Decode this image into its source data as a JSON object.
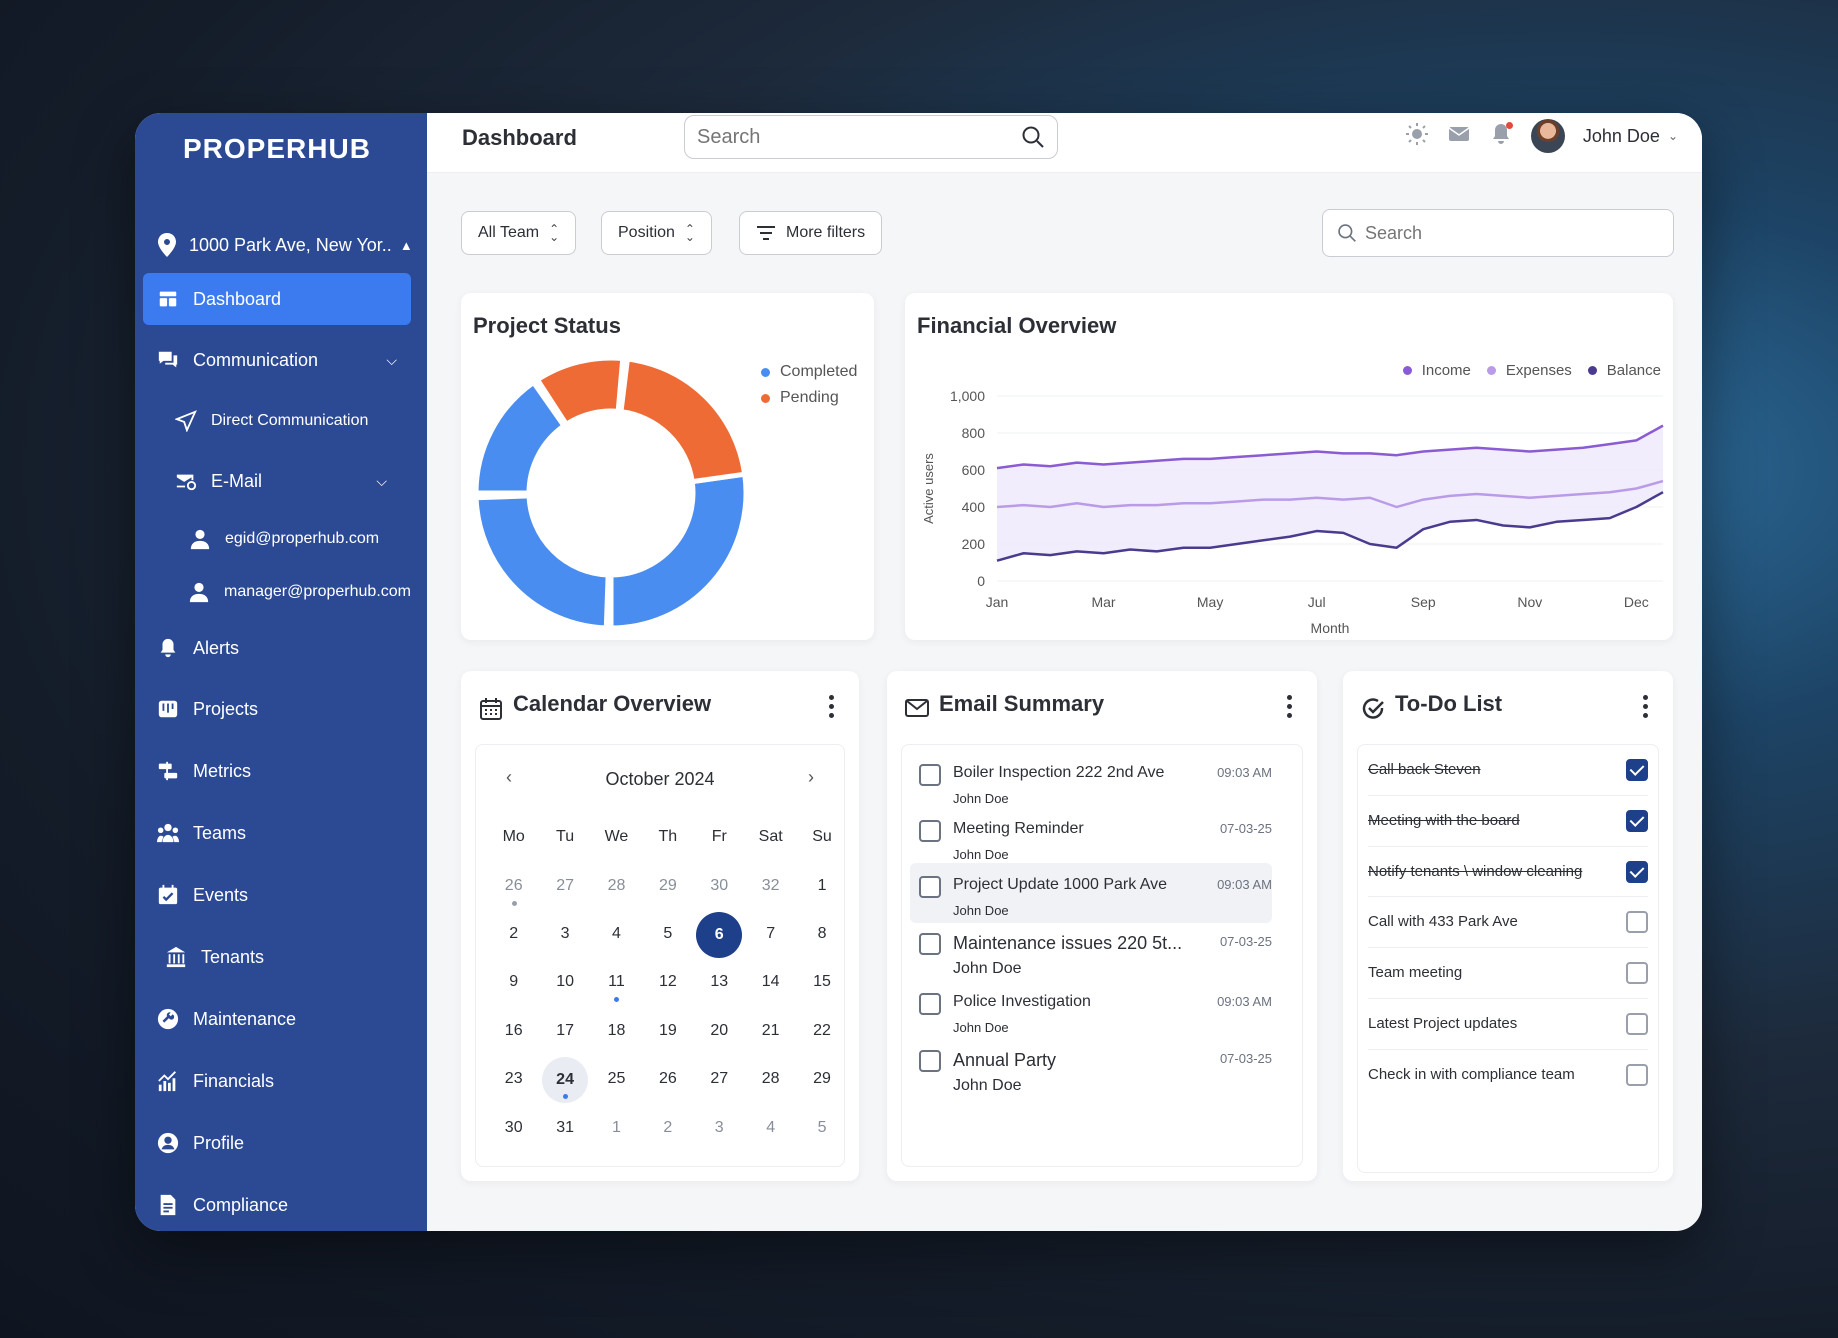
{
  "sidebar": {
    "logo": "PROPERHUB",
    "location": "1000 Park Ave, New Yor..",
    "items": [
      {
        "label": "Dashboard",
        "icon": "dashboard-icon"
      },
      {
        "label": "Communication",
        "icon": "chat-icon"
      },
      {
        "label": "Direct Communication",
        "icon": "send-icon"
      },
      {
        "label": "E-Mail",
        "icon": "mail-at-icon"
      },
      {
        "label": "egid@properhub.com",
        "icon": "user-icon"
      },
      {
        "label": "manager@properhub.com",
        "icon": "user-icon"
      },
      {
        "label": "Alerts",
        "icon": "bell-icon"
      },
      {
        "label": "Projects",
        "icon": "projects-icon"
      },
      {
        "label": "Metrics",
        "icon": "metrics-icon"
      },
      {
        "label": "Teams",
        "icon": "teams-icon"
      },
      {
        "label": "Events",
        "icon": "calendar-check-icon"
      },
      {
        "label": "Tenants",
        "icon": "building-icon"
      },
      {
        "label": "Maintenance",
        "icon": "wrench-icon"
      },
      {
        "label": "Financials",
        "icon": "chart-up-icon"
      },
      {
        "label": "Profile",
        "icon": "profile-icon"
      },
      {
        "label": "Compliance",
        "icon": "document-icon"
      }
    ]
  },
  "header": {
    "title": "Dashboard",
    "search_placeholder": "Search",
    "user_name": "John Doe"
  },
  "filters": {
    "team": "All Team",
    "position": "Position",
    "more": "More filters",
    "search_placeholder": "Search"
  },
  "project_status": {
    "title": "Project Status",
    "legend": [
      "Completed",
      "Pending"
    ],
    "colors": {
      "completed": "#4a8df0",
      "pending": "#ee6b35"
    }
  },
  "financial": {
    "title": "Financial Overview",
    "legend": [
      "Income",
      "Expenses",
      "Balance"
    ],
    "colors": {
      "income": "#8a5bd3",
      "expenses": "#b99be8",
      "balance": "#4a3b8f"
    }
  },
  "chart_data": [
    {
      "type": "pie",
      "title": "Project Status",
      "categories": [
        "Completed",
        "Pending"
      ],
      "values": [
        66,
        34
      ]
    },
    {
      "type": "line",
      "title": "Financial Overview",
      "xlabel": "Month",
      "ylabel": "Active users",
      "ylim": [
        0,
        1000
      ],
      "yticks": [
        "0",
        "200",
        "400",
        "600",
        "800",
        "1,000"
      ],
      "xticks": [
        "Jan",
        "Mar",
        "May",
        "Jul",
        "Sep",
        "Nov",
        "Dec"
      ],
      "legend_position": "top-right",
      "grid": true,
      "x": [
        0,
        0.5,
        1,
        1.5,
        2,
        2.5,
        3,
        3.5,
        4,
        4.5,
        5,
        5.5,
        6,
        6.5,
        7,
        7.5,
        8,
        8.5,
        9,
        9.5,
        10,
        10.5,
        11,
        11.5,
        12,
        12.5
      ],
      "series": [
        {
          "name": "Income",
          "values": [
            610,
            630,
            620,
            640,
            630,
            640,
            650,
            660,
            660,
            670,
            680,
            690,
            700,
            690,
            690,
            680,
            700,
            710,
            720,
            710,
            700,
            710,
            720,
            740,
            760,
            840
          ]
        },
        {
          "name": "Expenses",
          "values": [
            400,
            410,
            400,
            420,
            400,
            410,
            410,
            420,
            420,
            430,
            440,
            440,
            450,
            440,
            450,
            400,
            440,
            460,
            470,
            460,
            450,
            460,
            470,
            480,
            500,
            540
          ]
        },
        {
          "name": "Balance",
          "values": [
            110,
            150,
            140,
            160,
            150,
            170,
            160,
            180,
            180,
            200,
            220,
            240,
            270,
            260,
            200,
            180,
            280,
            320,
            330,
            300,
            290,
            320,
            330,
            340,
            400,
            480
          ]
        }
      ]
    }
  ],
  "calendar": {
    "title": "Calendar Overview",
    "month": "October 2024",
    "weekdays": [
      "Mo",
      "Tu",
      "We",
      "Th",
      "Fr",
      "Sat",
      "Su"
    ],
    "weeks": [
      [
        [
          "26",
          "muted",
          "gray"
        ],
        [
          "27",
          "muted",
          ""
        ],
        [
          "28",
          "muted",
          ""
        ],
        [
          "29",
          "muted",
          ""
        ],
        [
          "30",
          "muted",
          ""
        ],
        [
          "32",
          "muted",
          ""
        ],
        [
          "1",
          "",
          ""
        ]
      ],
      [
        [
          "2",
          "",
          ""
        ],
        [
          "3",
          "",
          ""
        ],
        [
          "4",
          "",
          ""
        ],
        [
          "5",
          "",
          ""
        ],
        [
          "6",
          "sel",
          ""
        ],
        [
          "7",
          "",
          ""
        ],
        [
          "8",
          "",
          ""
        ]
      ],
      [
        [
          "9",
          "",
          ""
        ],
        [
          "10",
          "",
          ""
        ],
        [
          "11",
          "",
          "blue"
        ],
        [
          "12",
          "",
          ""
        ],
        [
          "13",
          "",
          ""
        ],
        [
          "14",
          "",
          ""
        ],
        [
          "15",
          "",
          ""
        ]
      ],
      [
        [
          "16",
          "",
          ""
        ],
        [
          "17",
          "",
          ""
        ],
        [
          "18",
          "",
          ""
        ],
        [
          "19",
          "",
          ""
        ],
        [
          "20",
          "",
          ""
        ],
        [
          "21",
          "",
          ""
        ],
        [
          "22",
          "",
          ""
        ]
      ],
      [
        [
          "23",
          "",
          ""
        ],
        [
          "24",
          "today",
          "blue"
        ],
        [
          "25",
          "",
          ""
        ],
        [
          "26",
          "",
          ""
        ],
        [
          "27",
          "",
          ""
        ],
        [
          "28",
          "",
          ""
        ],
        [
          "29",
          "",
          ""
        ]
      ],
      [
        [
          "30",
          "",
          ""
        ],
        [
          "31",
          "",
          ""
        ],
        [
          "1",
          "muted",
          ""
        ],
        [
          "2",
          "muted",
          ""
        ],
        [
          "3",
          "muted",
          ""
        ],
        [
          "4",
          "muted",
          ""
        ],
        [
          "5",
          "muted",
          ""
        ]
      ]
    ]
  },
  "email": {
    "title": "Email Summary",
    "items": [
      {
        "subject": "Boiler Inspection 222 2nd Ave",
        "from": "John Doe",
        "time": "09:03 AM"
      },
      {
        "subject": "Meeting Reminder",
        "from": "John Doe",
        "time": "07-03-25"
      },
      {
        "subject": "Project Update 1000 Park Ave",
        "from": "John Doe",
        "time": "09:03 AM"
      },
      {
        "subject": "Maintenance issues 220 5t...",
        "from": "John Doe",
        "time": "07-03-25"
      },
      {
        "subject": "Police Investigation",
        "from": "John Doe",
        "time": "09:03 AM"
      },
      {
        "subject": "Annual Party",
        "from": "John Doe",
        "time": "07-03-25"
      }
    ]
  },
  "todo": {
    "title": "To-Do List",
    "items": [
      {
        "label": "Call back Steven",
        "done": true
      },
      {
        "label": "Meeting with the board",
        "done": true
      },
      {
        "label": "Notify tenants \\ window cleaning",
        "done": true
      },
      {
        "label": "Call with 433 Park Ave",
        "done": false
      },
      {
        "label": "Team meeting",
        "done": false
      },
      {
        "label": "Latest Project updates",
        "done": false
      },
      {
        "label": "Check in with compliance team",
        "done": false
      }
    ]
  }
}
